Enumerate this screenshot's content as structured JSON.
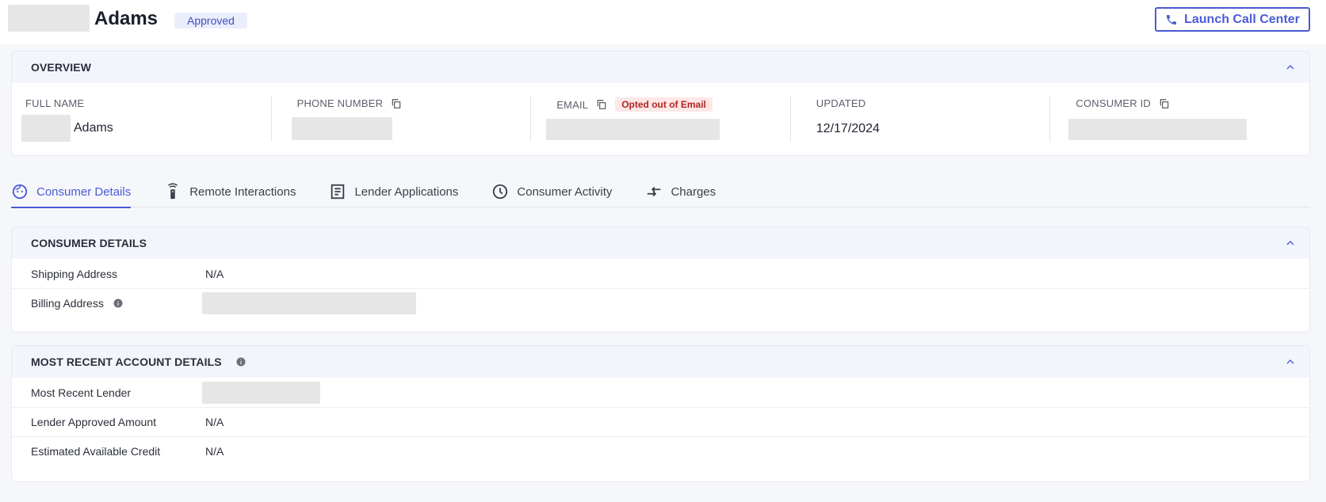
{
  "header": {
    "name": "Adams",
    "status": "Approved",
    "launch_label": "Launch Call Center"
  },
  "overview": {
    "title": "OVERVIEW",
    "full_name_label": "FULL NAME",
    "full_name_value": "Adams",
    "phone_label": "PHONE NUMBER",
    "email_label": "EMAIL",
    "email_badge": "Opted out of Email",
    "updated_label": "UPDATED",
    "updated_value": "12/17/2024",
    "consumer_id_label": "CONSUMER ID"
  },
  "tabs": [
    {
      "label": "Consumer Details",
      "icon": "face-icon",
      "active": true
    },
    {
      "label": "Remote Interactions",
      "icon": "remote-icon",
      "active": false
    },
    {
      "label": "Lender Applications",
      "icon": "document-icon",
      "active": false
    },
    {
      "label": "Consumer Activity",
      "icon": "clock-icon",
      "active": false
    },
    {
      "label": "Charges",
      "icon": "transfer-arrows-icon",
      "active": false
    }
  ],
  "consumer_details": {
    "title": "CONSUMER DETAILS",
    "rows": [
      {
        "label": "Shipping Address",
        "value": "N/A"
      },
      {
        "label": "Billing Address",
        "value": ""
      }
    ]
  },
  "account_details": {
    "title": "MOST RECENT ACCOUNT DETAILS",
    "rows": [
      {
        "label": "Most Recent Lender",
        "value": ""
      },
      {
        "label": "Lender Approved Amount",
        "value": "N/A"
      },
      {
        "label": "Estimated Available Credit",
        "value": "N/A"
      }
    ]
  },
  "colors": {
    "accent": "#4a5bd4",
    "badge_bg": "#eaeefb",
    "alert_text": "#b3261e",
    "alert_bg": "#fde7e7"
  }
}
